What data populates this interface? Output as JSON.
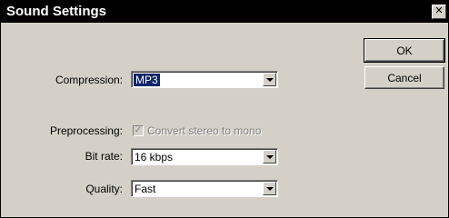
{
  "window": {
    "title": "Sound Settings",
    "close_glyph": "✕"
  },
  "buttons": {
    "ok": "OK",
    "cancel": "Cancel"
  },
  "compression": {
    "label": "Compression:",
    "value": "MP3"
  },
  "preprocessing": {
    "label": "Preprocessing:",
    "checkbox_label": "Convert stereo to mono",
    "checked": true,
    "enabled": false,
    "check_glyph": "✓"
  },
  "bit_rate": {
    "label": "Bit rate:",
    "value": "16 kbps"
  },
  "quality": {
    "label": "Quality:",
    "value": "Fast"
  }
}
